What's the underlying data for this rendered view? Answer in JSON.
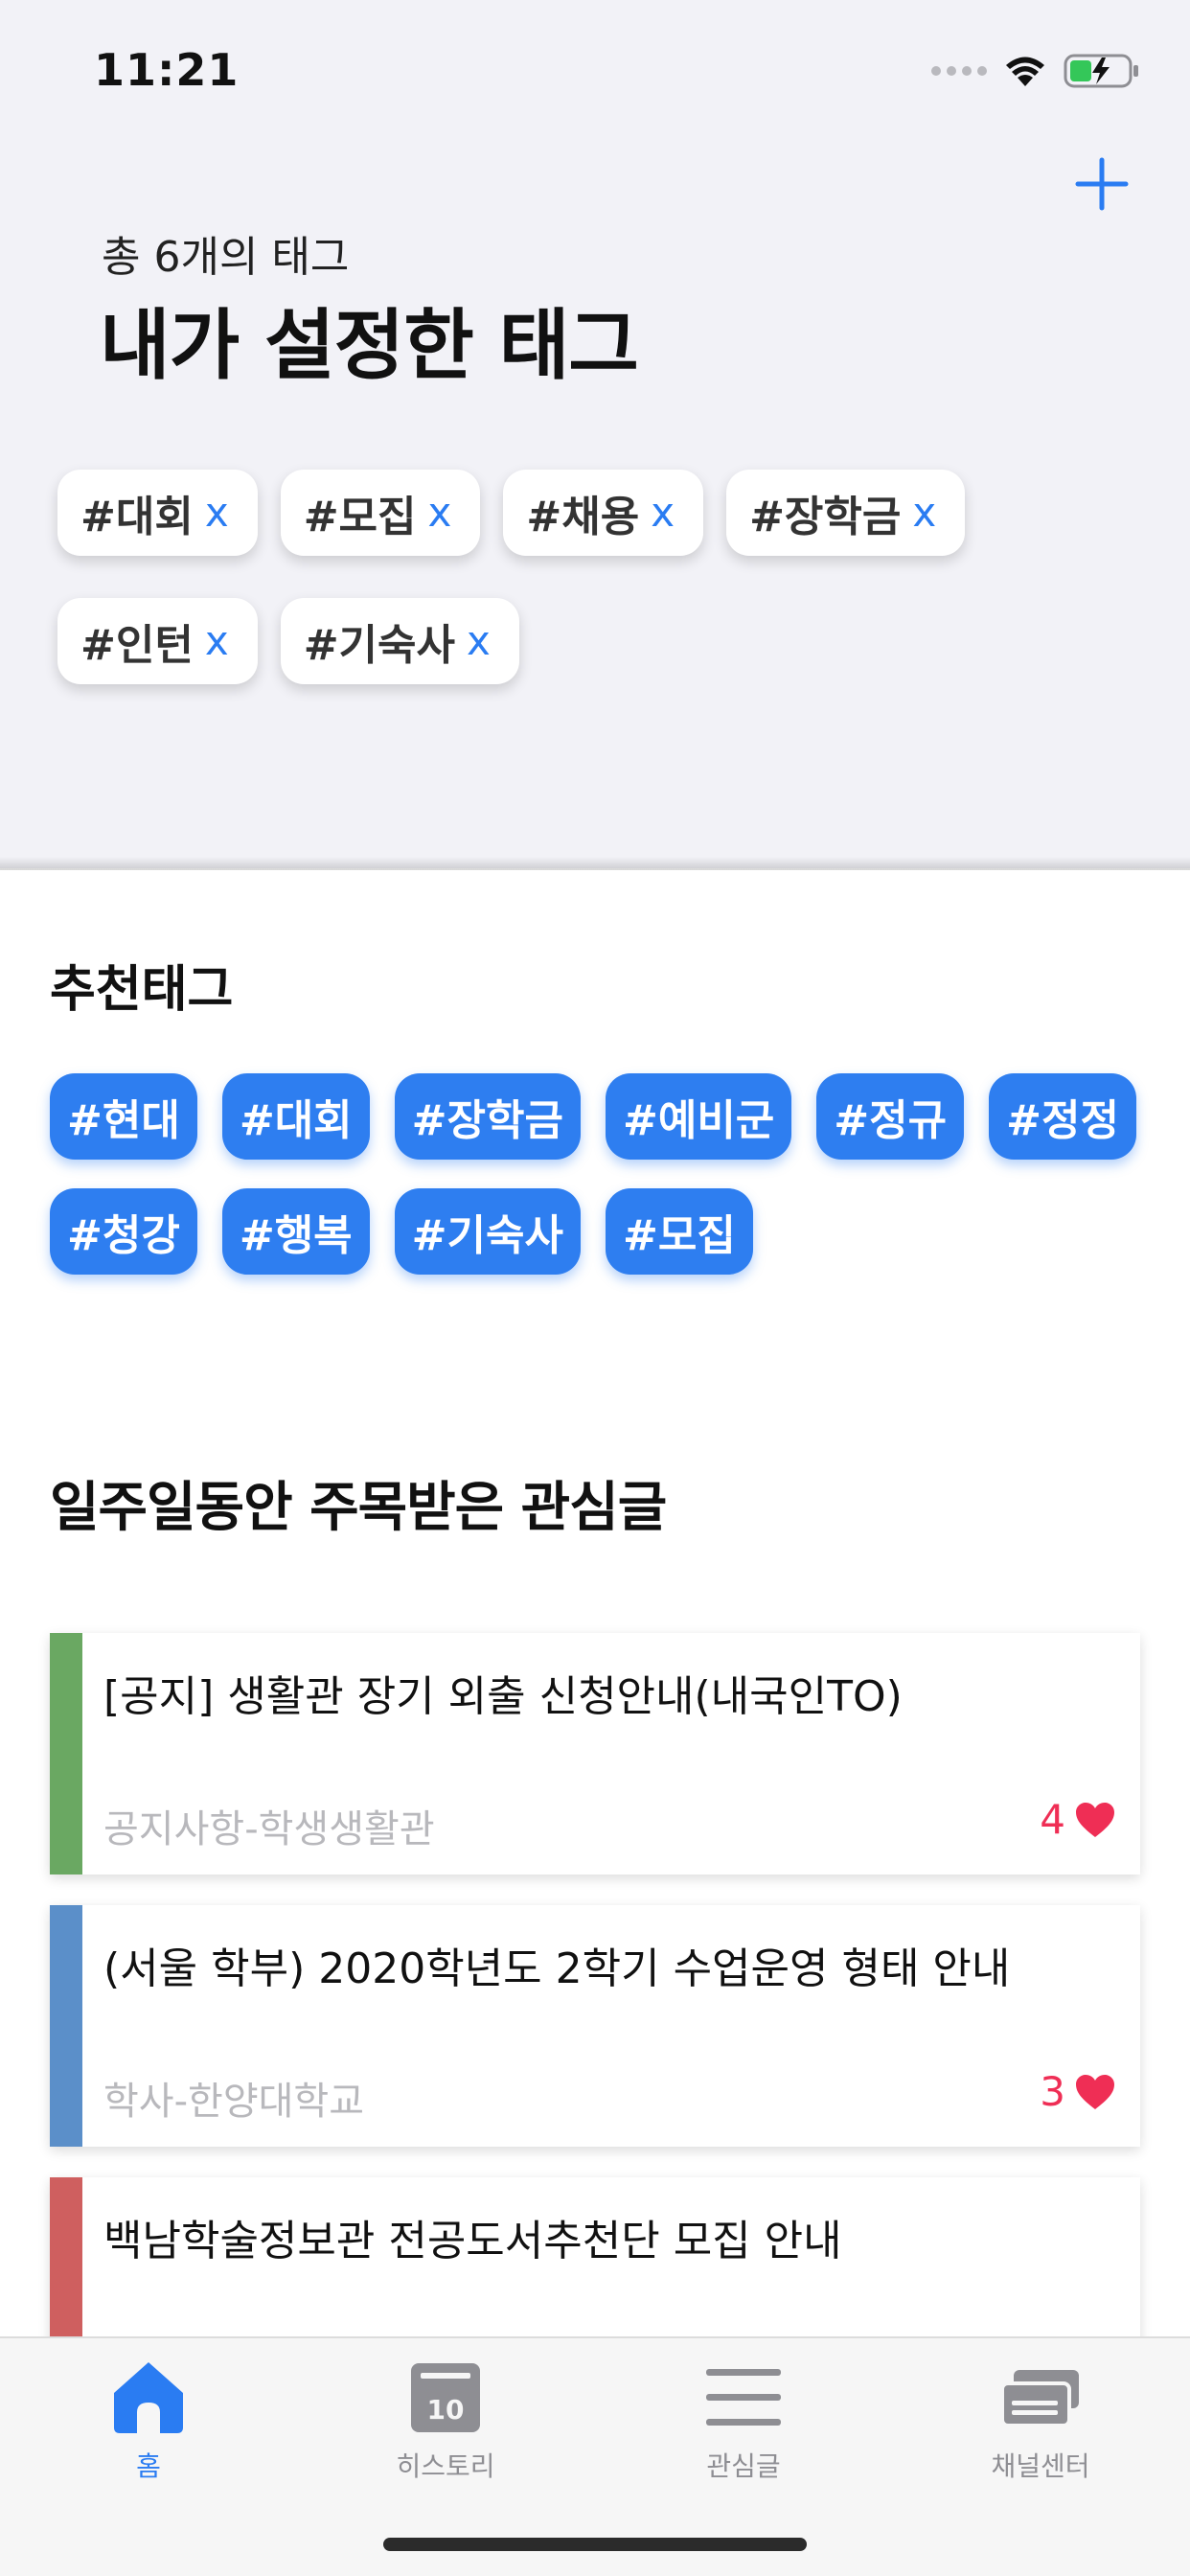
{
  "status_bar": {
    "time": "11:21"
  },
  "header": {
    "subtitle": "총 6개의 태그",
    "title": "내가 설정한 태그"
  },
  "my_tags": [
    {
      "label": "#대회",
      "remove": "x"
    },
    {
      "label": "#모집",
      "remove": "x"
    },
    {
      "label": "#채용",
      "remove": "x"
    },
    {
      "label": "#장학금",
      "remove": "x"
    },
    {
      "label": "#인턴",
      "remove": "x"
    },
    {
      "label": "#기숙사",
      "remove": "x"
    }
  ],
  "recommended": {
    "heading": "추천태그",
    "tags": [
      "#현대",
      "#대회",
      "#장학금",
      "#예비군",
      "#정규",
      "#정정",
      "#청강",
      "#행복",
      "#기숙사",
      "#모집"
    ]
  },
  "hot_posts": {
    "heading": "일주일동안 주목받은 관심글",
    "items": [
      {
        "title": "[공지] 생활관 장기 외출 신청안내(내국인TO)",
        "source": "공지사항-학생생활관",
        "likes": "4",
        "color": "#6aa862"
      },
      {
        "title": "(서울 학부) 2020학년도 2학기 수업운영 형태 안내",
        "source": "학사-한양대학교",
        "likes": "3",
        "color": "#5b8fc9"
      },
      {
        "title": "백남학술정보관 전공도서추천단 모집 안내",
        "source": "",
        "likes": "",
        "color": "#cf5f5f"
      }
    ]
  },
  "tabbar": {
    "home": "홈",
    "history": "히스토리",
    "history_icon_text": "10",
    "favorites": "관심글",
    "channel_center": "채널센터"
  },
  "colors": {
    "accent": "#2a7cf2",
    "tag_blue": "#2e7ef0",
    "heart": "#ef2e55"
  }
}
